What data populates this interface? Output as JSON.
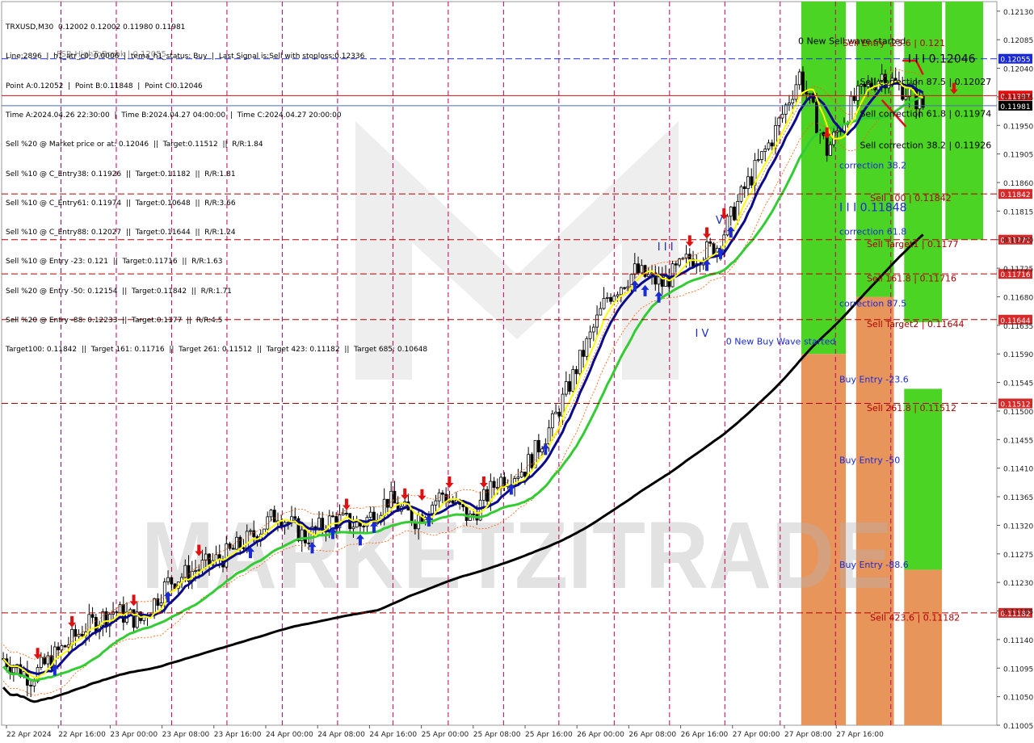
{
  "header": {
    "symbol_line": "TRXUSD,M30  0.12002 0.12002 0.11980 0.11981",
    "info_lines": [
      "Line:2896  |  h1_atr_c0: 0.0006  |  tema_h1_status: Buy  |  Last Signal is:Sell with stoploss:0.12336",
      "Point A:0.12052  |  Point B:0.11848  |  Point C:0.12046",
      "Time A:2024.04.26 22:30:00  |  Time B:2024.04.27 04:00:00  |  Time C:2024.04.27 20:00:00",
      "Sell %20 @ Market price or at: 0.12046  ||  Target:0.11512  ||  R/R:1.84",
      "Sell %10 @ C_Entry38: 0.11926  ||  Target:0.11182  ||  R/R:1.81",
      "Sell %10 @ C_Entry61: 0.11974  ||  Target:0.10648  ||  R/R:3.66",
      "Sell %10 @ C_Entry88: 0.12027  ||  Target:0.11644  ||  R/R:1.24",
      "Sell %10 @ Entry -23: 0.121  ||  Target:0.11716  ||  R/R:1.63",
      "Sell %20 @ Entry -50: 0.12154  ||  Target:0.11842  ||  R/R:1.71",
      "Sell %20 @ Entry -88: 0.12233  ||  Target:0.1177  ||  R/R:4.5",
      "Target100: 0.11842  ||  Target 161: 0.11716  ||  Target 261: 0.11512  ||  Target 423: 0.11182  ||  Target 685: 0.10648"
    ],
    "overlay_text": "FSB-HighToBreak  |  0.12055"
  },
  "chart_data": {
    "type": "candlestick",
    "symbol": "TRXUSD",
    "timeframe": "M30",
    "ylim": [
      0.11005,
      0.12145
    ],
    "y_ticks": [
      0.11005,
      0.1105,
      0.11095,
      0.1114,
      0.11185,
      0.1123,
      0.11275,
      0.1132,
      0.11365,
      0.1141,
      0.11455,
      0.115,
      0.11545,
      0.1159,
      0.11635,
      0.1168,
      0.11725,
      0.1177,
      0.11815,
      0.1186,
      0.11905,
      0.1195,
      0.11995,
      0.1204,
      0.12085,
      0.1213
    ],
    "x_ticks": [
      "22 Apr 2024",
      "22 Apr 16:00",
      "23 Apr 00:00",
      "23 Apr 08:00",
      "23 Apr 16:00",
      "24 Apr 00:00",
      "24 Apr 08:00",
      "24 Apr 16:00",
      "25 Apr 00:00",
      "25 Apr 08:00",
      "25 Apr 16:00",
      "26 Apr 00:00",
      "26 Apr 08:00",
      "26 Apr 16:00",
      "27 Apr 00:00",
      "27 Apr 08:00",
      "27 Apr 16:00"
    ],
    "price_anchors": [
      [
        0,
        0.1111
      ],
      [
        8,
        0.1108
      ],
      [
        16,
        0.1112
      ],
      [
        24,
        0.1116
      ],
      [
        32,
        0.11185
      ],
      [
        40,
        0.1117
      ],
      [
        48,
        0.1123
      ],
      [
        56,
        0.1125
      ],
      [
        64,
        0.1127
      ],
      [
        72,
        0.113
      ],
      [
        80,
        0.1134
      ],
      [
        88,
        0.113
      ],
      [
        96,
        0.1133
      ],
      [
        104,
        0.1132
      ],
      [
        112,
        0.1136
      ],
      [
        120,
        0.1133
      ],
      [
        128,
        0.1137
      ],
      [
        136,
        0.1133
      ],
      [
        144,
        0.1139
      ],
      [
        152,
        0.1141
      ],
      [
        160,
        0.1148
      ],
      [
        168,
        0.1158
      ],
      [
        176,
        0.1168
      ],
      [
        184,
        0.1172
      ],
      [
        192,
        0.117
      ],
      [
        200,
        0.1174
      ],
      [
        208,
        0.1176
      ],
      [
        216,
        0.1185
      ],
      [
        224,
        0.1193
      ],
      [
        232,
        0.1203
      ],
      [
        240,
        0.1191
      ],
      [
        248,
        0.1199
      ],
      [
        256,
        0.1203
      ],
      [
        264,
        0.12
      ],
      [
        268,
        0.1198
      ]
    ],
    "horizontal_lines": [
      {
        "price": 0.12055,
        "color": "#1a2bd6",
        "style": "dashed",
        "label": "0.12055",
        "label_bg": "#1a2bd6"
      },
      {
        "price": 0.11997,
        "color": "#e01010",
        "style": "solid",
        "label": "0.11997",
        "label_bg": "#e01010"
      },
      {
        "price": 0.11981,
        "color": "#4a6fa5",
        "style": "solid",
        "label": "0.11981",
        "label_bg": "#000000"
      },
      {
        "price": 0.11842,
        "color": "#b00000",
        "style": "dashed",
        "label": "0.11842",
        "label_bg": "#d42a2a"
      },
      {
        "price": 0.1177,
        "color": "#b00000",
        "style": "dashed",
        "label": "0.11770",
        "label_bg": "#d42a2a"
      },
      {
        "price": 0.11716,
        "color": "#b00000",
        "style": "dashed",
        "label": "0.11716",
        "label_bg": "#d42a2a"
      },
      {
        "price": 0.11644,
        "color": "#b00000",
        "style": "dashed",
        "label": "0.11644",
        "label_bg": "#d42a2a"
      },
      {
        "price": 0.11512,
        "color": "#b00000",
        "style": "dashed",
        "label": "0.11512",
        "label_bg": "#d42a2a"
      },
      {
        "price": 0.11182,
        "color": "#b00000",
        "style": "dashed",
        "label": "0.11182",
        "label_bg": "#d42a2a"
      }
    ],
    "annotations": [
      {
        "text": "0 New Sell wave started",
        "price": 0.12078,
        "bar": 233,
        "color": "#000000"
      },
      {
        "text": "Sell Entry -23.6 | 0.121",
        "price": 0.12075,
        "bar": 246,
        "color": "#b00000"
      },
      {
        "text": "I I I 0.12046",
        "price": 0.12049,
        "bar": 265,
        "color": "#000000"
      },
      {
        "text": "Sell correction 87.5 | 0.12027",
        "price": 0.12014,
        "bar": 251,
        "color": "#000000"
      },
      {
        "text": "Sell correction 61.8 | 0.11974",
        "price": 0.11964,
        "bar": 251,
        "color": "#000000"
      },
      {
        "text": "Sell correction 38.2 | 0.11926",
        "price": 0.11914,
        "bar": 251,
        "color": "#000000"
      },
      {
        "text": "correction 38.2",
        "price": 0.11882,
        "bar": 245,
        "color": "#1a2bd6"
      },
      {
        "text": "Sell 100 | 0.11842",
        "price": 0.11831,
        "bar": 254,
        "color": "#b00000"
      },
      {
        "text": "I I I 0.11848",
        "price": 0.11815,
        "bar": 245,
        "color": "#1a2bd6"
      },
      {
        "text": "correction 61.8",
        "price": 0.11778,
        "bar": 245,
        "color": "#1a2bd6"
      },
      {
        "text": "Sell Target1 | 0.1177",
        "price": 0.11758,
        "bar": 253,
        "color": "#b00000"
      },
      {
        "text": "Sell 161.8 | 0.11716",
        "price": 0.11704,
        "bar": 253,
        "color": "#b00000"
      },
      {
        "text": "correction 87.5",
        "price": 0.11665,
        "bar": 245,
        "color": "#1a2bd6"
      },
      {
        "text": "Sell Target2 | 0.11644",
        "price": 0.11632,
        "bar": 253,
        "color": "#b00000"
      },
      {
        "text": "I I I",
        "price": 0.11753,
        "bar": 192,
        "color": "#1a2bd6"
      },
      {
        "text": "V",
        "price": 0.11795,
        "bar": 209,
        "color": "#1a2bd6"
      },
      {
        "text": "I V",
        "price": 0.11617,
        "bar": 203,
        "color": "#1a2bd6"
      },
      {
        "text": "0 New Buy Wave started",
        "price": 0.11605,
        "bar": 212,
        "color": "#1a2bd6"
      },
      {
        "text": "Buy Entry -23.6",
        "price": 0.11545,
        "bar": 245,
        "color": "#1a2bd6"
      },
      {
        "text": "Sell 261.8 | 0.11512",
        "price": 0.115,
        "bar": 253,
        "color": "#b00000"
      },
      {
        "text": "Buy Entry -50",
        "price": 0.11418,
        "bar": 245,
        "color": "#1a2bd6"
      },
      {
        "text": "Buy Entry -88.6",
        "price": 0.11253,
        "bar": 245,
        "color": "#1a2bd6"
      },
      {
        "text": "Sell 423.6 | 0.11182",
        "price": 0.1117,
        "bar": 254,
        "color": "#b00000"
      }
    ],
    "zones": [
      {
        "bars": [
          233,
          246
        ],
        "from": 0.11005,
        "to": 0.1159,
        "color": "#e8955c"
      },
      {
        "bars": [
          233,
          246
        ],
        "from": 0.1159,
        "to": 0.12145,
        "color": "#4cd424"
      },
      {
        "bars": [
          249,
          260
        ],
        "from": 0.11005,
        "to": 0.1168,
        "color": "#e8955c"
      },
      {
        "bars": [
          249,
          260
        ],
        "from": 0.1168,
        "to": 0.12145,
        "color": "#4cd424"
      },
      {
        "bars": [
          263,
          274
        ],
        "from": 0.11005,
        "to": 0.1125,
        "color": "#e8955c"
      },
      {
        "bars": [
          263,
          274
        ],
        "from": 0.1125,
        "to": 0.11535,
        "color": "#4cd424"
      },
      {
        "bars": [
          263,
          274
        ],
        "from": 0.1164,
        "to": 0.12145,
        "color": "#4cd424"
      },
      {
        "bars": [
          275,
          286
        ],
        "from": 0.1177,
        "to": 0.12145,
        "color": "#4cd424"
      }
    ],
    "vertical_separators": 16,
    "colors": {
      "bull": "#ffffff",
      "bear": "#000000",
      "wick": "#000000",
      "ma_fast": "#ffff00",
      "ma_mid": "#0a0a8c",
      "ma_slow": "#33cc33",
      "ma_long": "#000000",
      "envelope": "#ff5a00",
      "separator": "#c0005a",
      "grid": "#ffffff",
      "buy_arrow": "#1a2bd6",
      "sell_arrow": "#e01010"
    },
    "watermark": "MARKETZITRADE"
  }
}
